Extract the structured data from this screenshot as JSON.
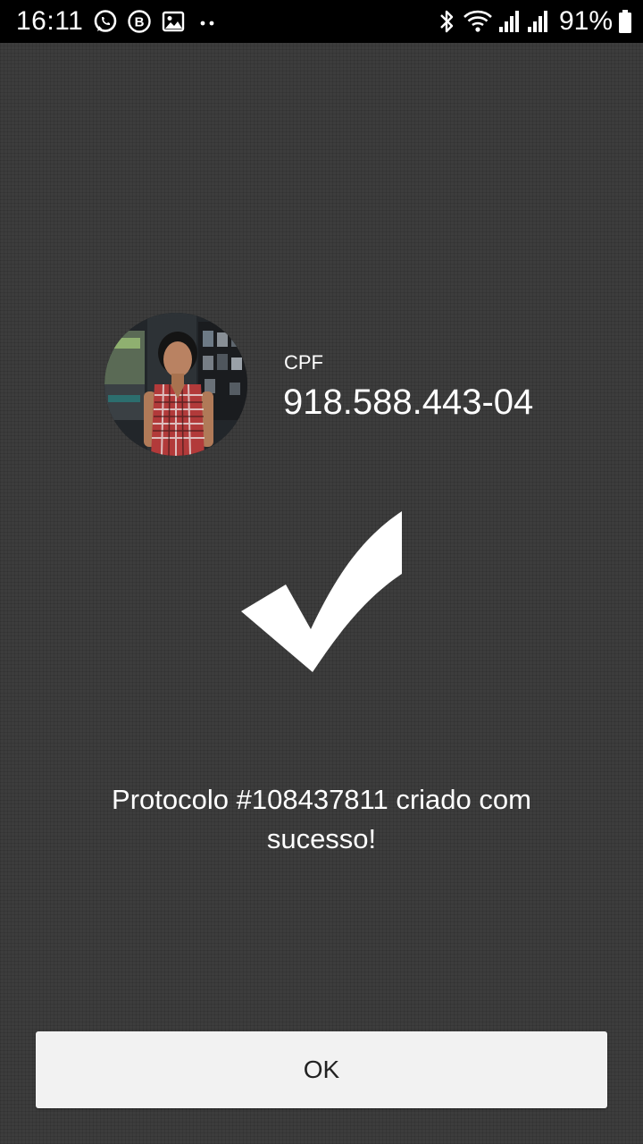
{
  "status_bar": {
    "time": "16:11",
    "battery_percent": "91%",
    "left_icons": [
      "whatsapp-icon",
      "business-icon",
      "gallery-icon",
      "more-dots-icon"
    ],
    "right_icons": [
      "bluetooth-icon",
      "wifi-icon",
      "signal-icon",
      "signal-icon",
      "battery-icon"
    ]
  },
  "profile": {
    "cpf_label": "CPF",
    "cpf_value": "918.588.443-04"
  },
  "result": {
    "icon": "checkmark-icon",
    "message": "Protocolo #108437811 criado com sucesso!"
  },
  "actions": {
    "ok_label": "OK"
  },
  "colors": {
    "background": "#3d3d3d",
    "status_bar": "#000000",
    "text": "#ffffff",
    "button_bg": "#f2f2f2",
    "button_text": "#222222"
  }
}
